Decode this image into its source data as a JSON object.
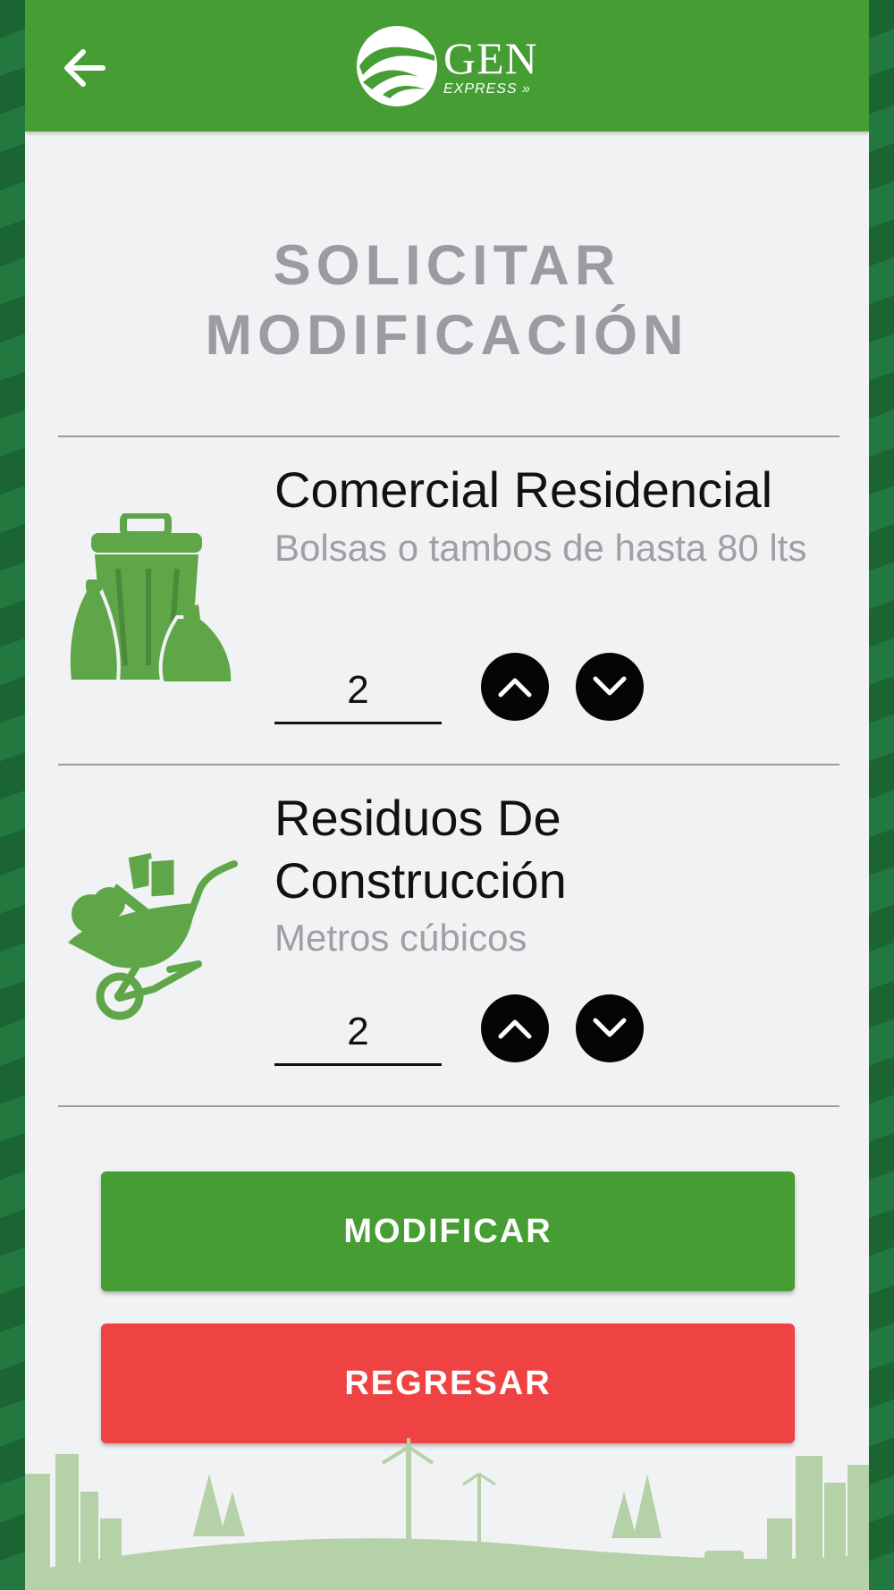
{
  "header": {
    "back_icon": "arrow-left-icon",
    "logo": {
      "brand": "GEN",
      "sub": "EXPRESS"
    },
    "color": "#459d33"
  },
  "page": {
    "title_line1": "SOLICITAR",
    "title_line2": "MODIFICACIÓN"
  },
  "services": [
    {
      "name": "Comercial Residencial",
      "description": "Bolsas o tambos de hasta 80 lts",
      "quantity": "2",
      "icon": "trash-can-bags-icon"
    },
    {
      "name": "Residuos De Construcción",
      "description": "Metros cúbicos",
      "quantity": "2",
      "icon": "wheelbarrow-icon"
    }
  ],
  "actions": {
    "modify_label": "MODIFICAR",
    "back_label": "REGRESAR"
  },
  "colors": {
    "primary_green": "#459d33",
    "danger_red": "#ef4343",
    "icon_green": "#5fa649",
    "background": "#f1f2f4"
  }
}
